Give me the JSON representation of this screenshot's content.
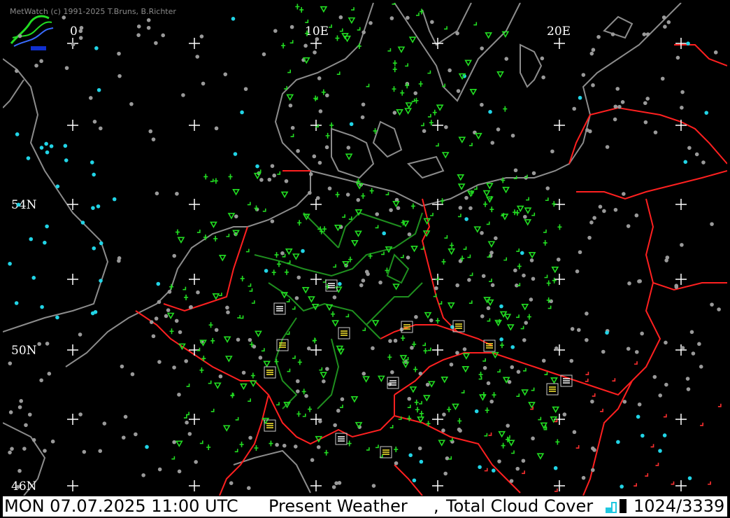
{
  "app": {
    "copyright": "MetWatch  (c) 1991-2025 T.Bruns, B.Richter"
  },
  "map": {
    "longitude_labels": [
      "0",
      "10E",
      "20E"
    ],
    "latitude_labels": [
      "54N",
      "50N",
      "46N"
    ],
    "colors": {
      "background": "#000000",
      "coastline": "#8c8c8c",
      "country_border": "#ff2020",
      "region_border": "#1f8f1f",
      "grid_cross": "#ffffff",
      "station_clear": "#9a9a9a",
      "station_cloud": "#21d4e6",
      "weather_symbol": "#22dd22",
      "warning_symbol": "#ff3030",
      "fog_symbol": "#ffee33"
    }
  },
  "status": {
    "datetime": "MON 07.07.2025 11:00 UTC",
    "product": "Present Weather",
    "separator": ",",
    "overlay": "Total Cloud Cover",
    "counter": "1024/3339"
  }
}
